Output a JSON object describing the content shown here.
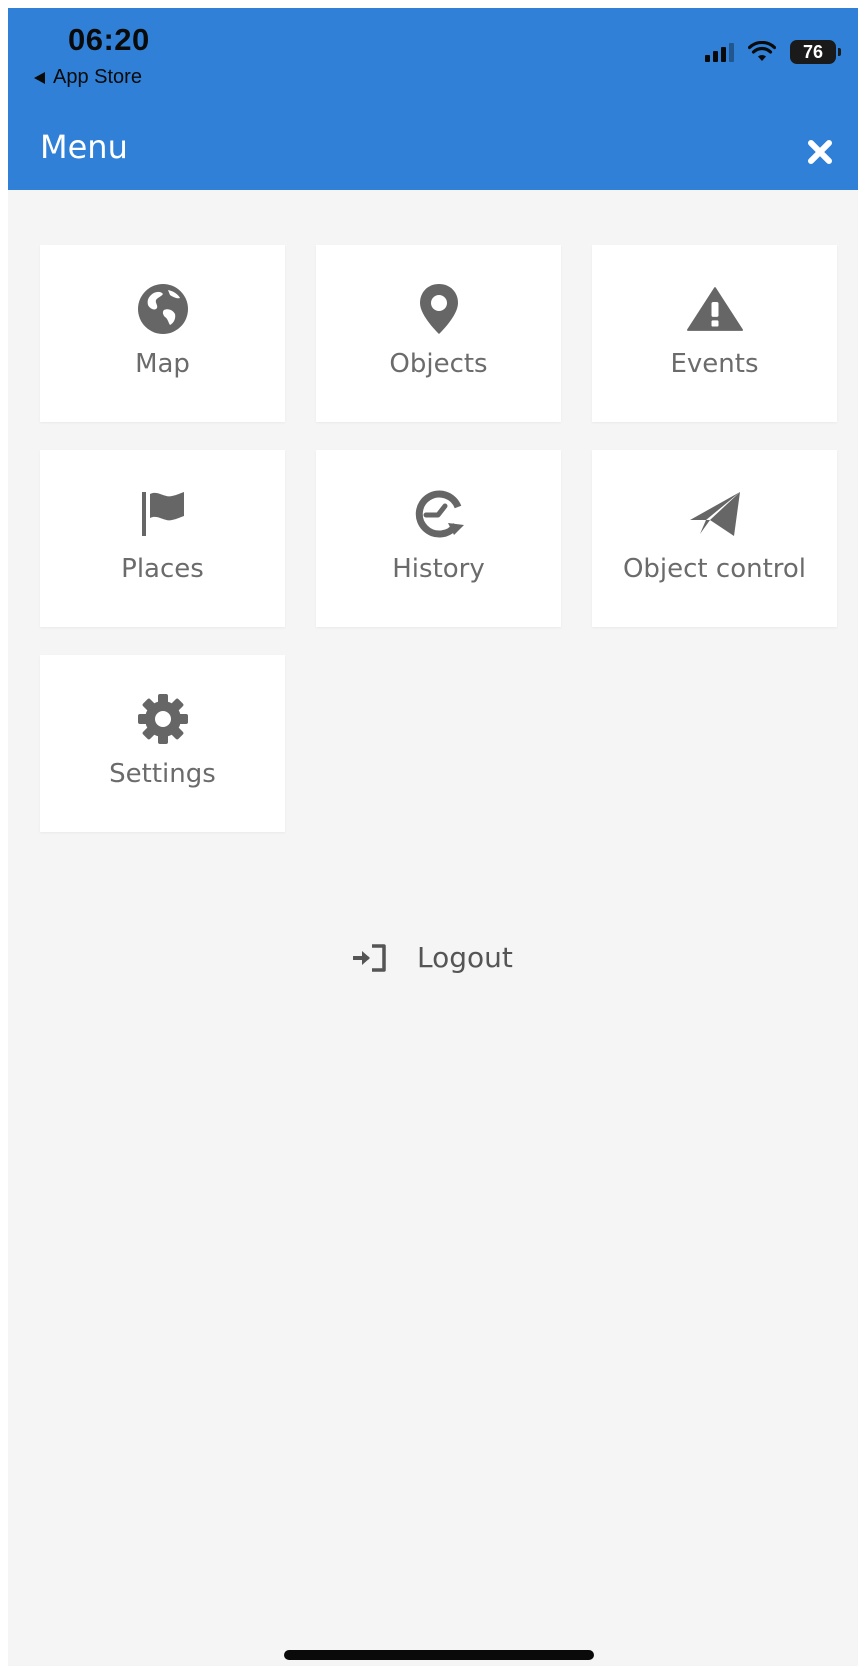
{
  "status_bar": {
    "time": "06:20",
    "back_label": "App Store",
    "battery": "76"
  },
  "header": {
    "title": "Menu",
    "close_icon": "close-icon",
    "background_color": "#2f80d6"
  },
  "menu_items": [
    {
      "label": "Map",
      "icon": "globe-icon"
    },
    {
      "label": "Objects",
      "icon": "map-pin-icon"
    },
    {
      "label": "Events",
      "icon": "warning-icon"
    },
    {
      "label": "Places",
      "icon": "flag-icon"
    },
    {
      "label": "History",
      "icon": "history-icon"
    },
    {
      "label": "Object control",
      "icon": "paper-plane-icon"
    },
    {
      "label": "Settings",
      "icon": "gear-icon"
    }
  ],
  "logout": {
    "label": "Logout",
    "icon": "sign-out-icon"
  },
  "colors": {
    "icon": "#666666",
    "label": "#6b6b6b",
    "page_background": "#f5f5f5"
  }
}
